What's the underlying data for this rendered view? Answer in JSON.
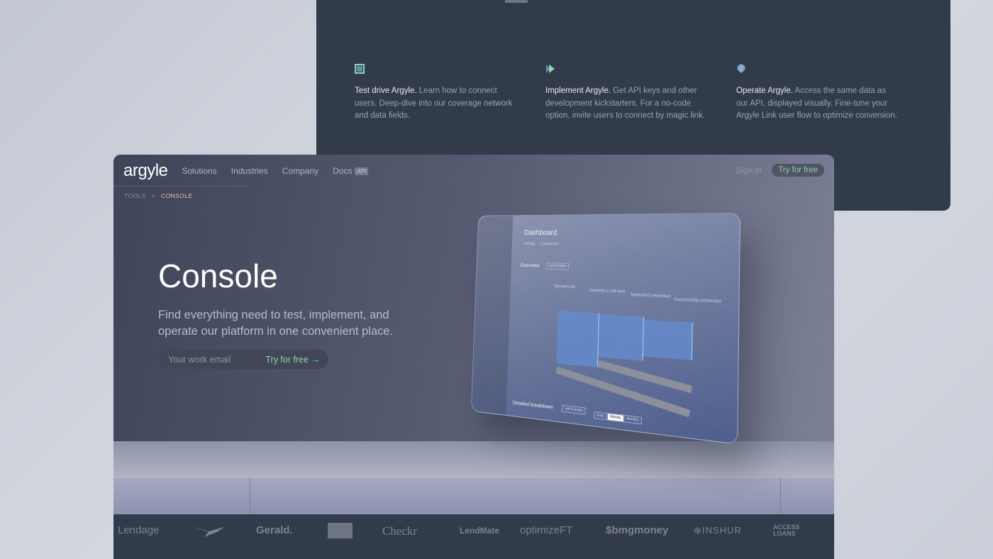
{
  "features": [
    {
      "icon": "frame-icon",
      "title": "Test drive Argyle.",
      "text": "Learn how to connect users. Deep-dive into our coverage network and data fields."
    },
    {
      "icon": "play-icon",
      "title": "Implement Argyle.",
      "text": "Get API keys and other development kickstarters. For a no-code option, invite users to connect by magic link."
    },
    {
      "icon": "balloon-icon",
      "title": "Operate Argyle.",
      "text": "Access the same data as our API, displayed visually. Fine-tune your Argyle Link user flow to optimize conversion."
    }
  ],
  "nav": {
    "logo": "argyle",
    "items": [
      "Solutions",
      "Industries",
      "Company",
      "Docs"
    ],
    "api_badge": "API",
    "sign_in": "Sign in",
    "try": "Try for free"
  },
  "breadcrumb": {
    "root": "TOOLS",
    "sep": ">",
    "current": "CONSOLE"
  },
  "hero": {
    "title": "Console",
    "subtitle": "Find everything need to test, implement, and operate our platform in one convenient place.",
    "email_placeholder": "Your work email",
    "cta": "Try for free →"
  },
  "dashboard": {
    "title": "Dashboard",
    "tabs": [
      "Activity",
      "Conversion"
    ],
    "overview": "Overview",
    "range": "Last 8 weeks",
    "steps": [
      "Opened Link",
      "Selected a Link item",
      "Submitted credentials",
      "Successfully connected"
    ],
    "breakdown": "Detailed breakdown",
    "toggles": [
      "Daily",
      "Weekly",
      "Monthly"
    ]
  },
  "logos": [
    "Lendage",
    "Gerald.",
    "Checkr",
    "LendMate",
    "optimizeFT",
    "$bmgmoney",
    "⊕INSHUR",
    "ACCESS LOANS"
  ],
  "colors": {
    "accent_green": "#8dd3a7",
    "breadcrumb_current": "#e6b9a8",
    "panel_dark": "#323b4a"
  }
}
